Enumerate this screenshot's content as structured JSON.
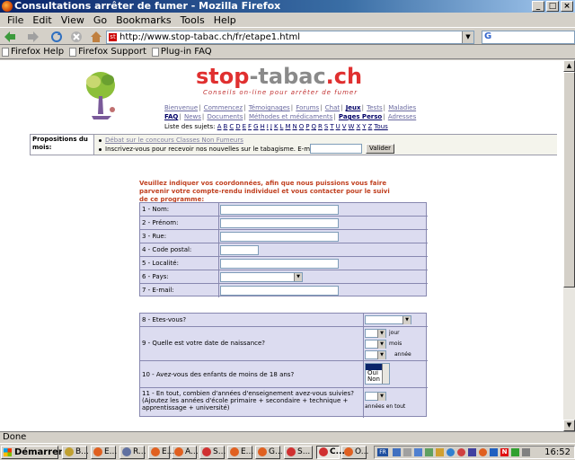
{
  "window": {
    "title": "Consultations arrêter de fumer - Mozilla Firefox"
  },
  "menu": [
    "File",
    "Edit",
    "View",
    "Go",
    "Bookmarks",
    "Tools",
    "Help"
  ],
  "nav": {
    "url": "http://www.stop-tabac.ch/fr/etape1.html",
    "search_prefix": "G"
  },
  "bookmarks": [
    "Firefox Help",
    "Firefox Support",
    "Plug-in FAQ"
  ],
  "site": {
    "logo_main": "stop",
    "logo_dash": "-tabac",
    "logo_tld": ".ch",
    "slogan": "Conseils on-line pour arrêter de fumer",
    "nav_row1": [
      "Bienvenue",
      "Commencez",
      "Témoignages",
      "Forums",
      "Chat",
      "Jeux",
      "Tests",
      "Maladies"
    ],
    "nav_row2": [
      "FAQ",
      "News",
      "Documents",
      "Méthodes et médicaments",
      "Pages Perso",
      "Adresses"
    ],
    "subjects_label": "Liste des sujets:",
    "letters": [
      "A",
      "B",
      "C",
      "D",
      "E",
      "F",
      "G",
      "H",
      "I",
      "J",
      "K",
      "L",
      "M",
      "N",
      "O",
      "P",
      "Q",
      "R",
      "S",
      "T",
      "U",
      "V",
      "W",
      "X",
      "Y",
      "Z",
      "Tous"
    ],
    "prop_label": "Propositions du mois:",
    "prop_item1": "Débat sur le concours Classes Non Fumeurs",
    "prop_item2": "Inscrivez-vous pour recevoir nos nouvelles sur le tabagisme. E-mail:",
    "valider": "Valider"
  },
  "form": {
    "intro": "Veuillez indiquer vos coordonnées, afin que nous puissions vous faire parvenir votre compte-rendu individuel et vous contacter pour le suivi de ce programme:",
    "fields": [
      "1 - Nom:",
      "2 - Prénom:",
      "3 - Rue:",
      "4 - Code postal:",
      "5 - Localité:",
      "6 - Pays:",
      "7 - E-mail:"
    ],
    "q8": "8 - Etes-vous?",
    "q9": "9 - Quelle est votre date de naissance?",
    "q9_units": [
      "jour",
      "mois",
      "année"
    ],
    "q10": "10 - Avez-vous des enfants de moins de 18 ans?",
    "q10_options": [
      "Oui",
      "Non"
    ],
    "q11": "11 - En tout, combien d'années d'enseignement avez-vous suivies? (Ajoutez les années d'école primaire + secondaire + technique + apprentissage + université)",
    "q11_unit": "années en tout"
  },
  "status": "Done",
  "taskbar": {
    "start": "Démarrer",
    "tasks": [
      "B...",
      "E...",
      "R...",
      "E...",
      "A...",
      "S...",
      "E...",
      "G...",
      "S...",
      "C...",
      "O..."
    ],
    "lang": "FR",
    "clock": "16:52"
  }
}
